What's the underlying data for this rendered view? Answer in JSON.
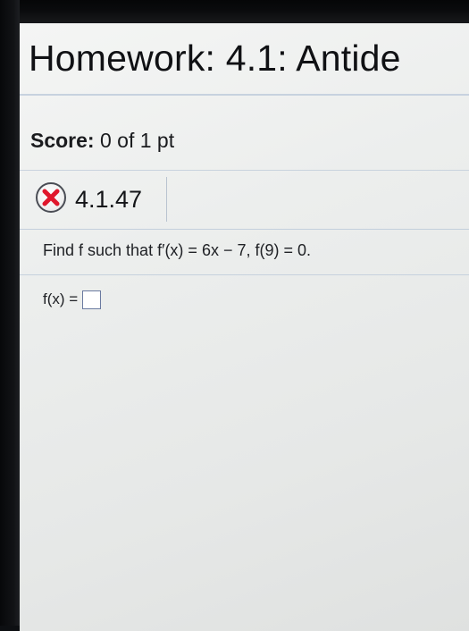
{
  "header": {
    "title": "Homework: 4.1: Antide"
  },
  "score": {
    "label": "Score:",
    "value": "0 of 1 pt"
  },
  "question": {
    "number": "4.1.47",
    "status_icon": "incorrect-x-icon",
    "status_color": "#e0172c",
    "prompt": "Find f such that f′(x) = 6x − 7, f(9) = 0.",
    "answer_label": "f(x) =",
    "answer_value": ""
  }
}
